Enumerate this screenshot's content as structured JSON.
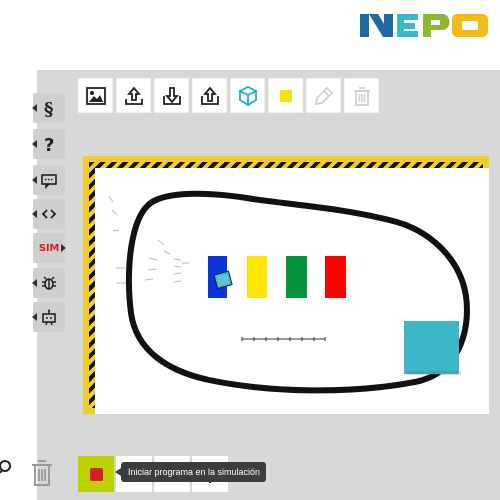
{
  "app": {
    "logo_text": "NEPO",
    "colors": {
      "accent": "#3cb7c7",
      "logo_blue": "#1d6aa6",
      "logo_cyan": "#3cb7c7",
      "logo_green": "#8cb92e",
      "logo_yellow": "#f2bb1a",
      "workspace_bg": "#d8d8d8",
      "stop_button": "#bed000",
      "red": "#d61d20"
    }
  },
  "toolbar": {
    "icons": [
      "image-icon",
      "upload-icon",
      "download-icon",
      "import-icon",
      "cube-icon",
      "yellow-square-icon",
      "eyedropper-icon",
      "trash-icon"
    ]
  },
  "side_tabs": [
    {
      "name": "program-tab",
      "icon": "section-icon"
    },
    {
      "name": "help-tab",
      "icon": "question-icon"
    },
    {
      "name": "code-tab",
      "icon": "message-icon"
    },
    {
      "name": "source-tab",
      "icon": "code-icon"
    },
    {
      "name": "sim-tab",
      "label": "SIM"
    },
    {
      "name": "debug-tab",
      "icon": "bug-icon"
    },
    {
      "name": "robot-tab",
      "icon": "robot-icon"
    }
  ],
  "simulation": {
    "tooltip": "Iniciar programa en la simulación"
  },
  "bottom": {
    "trash_icon": "trash-icon",
    "zoom_icon": "zoom-icon",
    "stop_icon": "stop-icon"
  }
}
